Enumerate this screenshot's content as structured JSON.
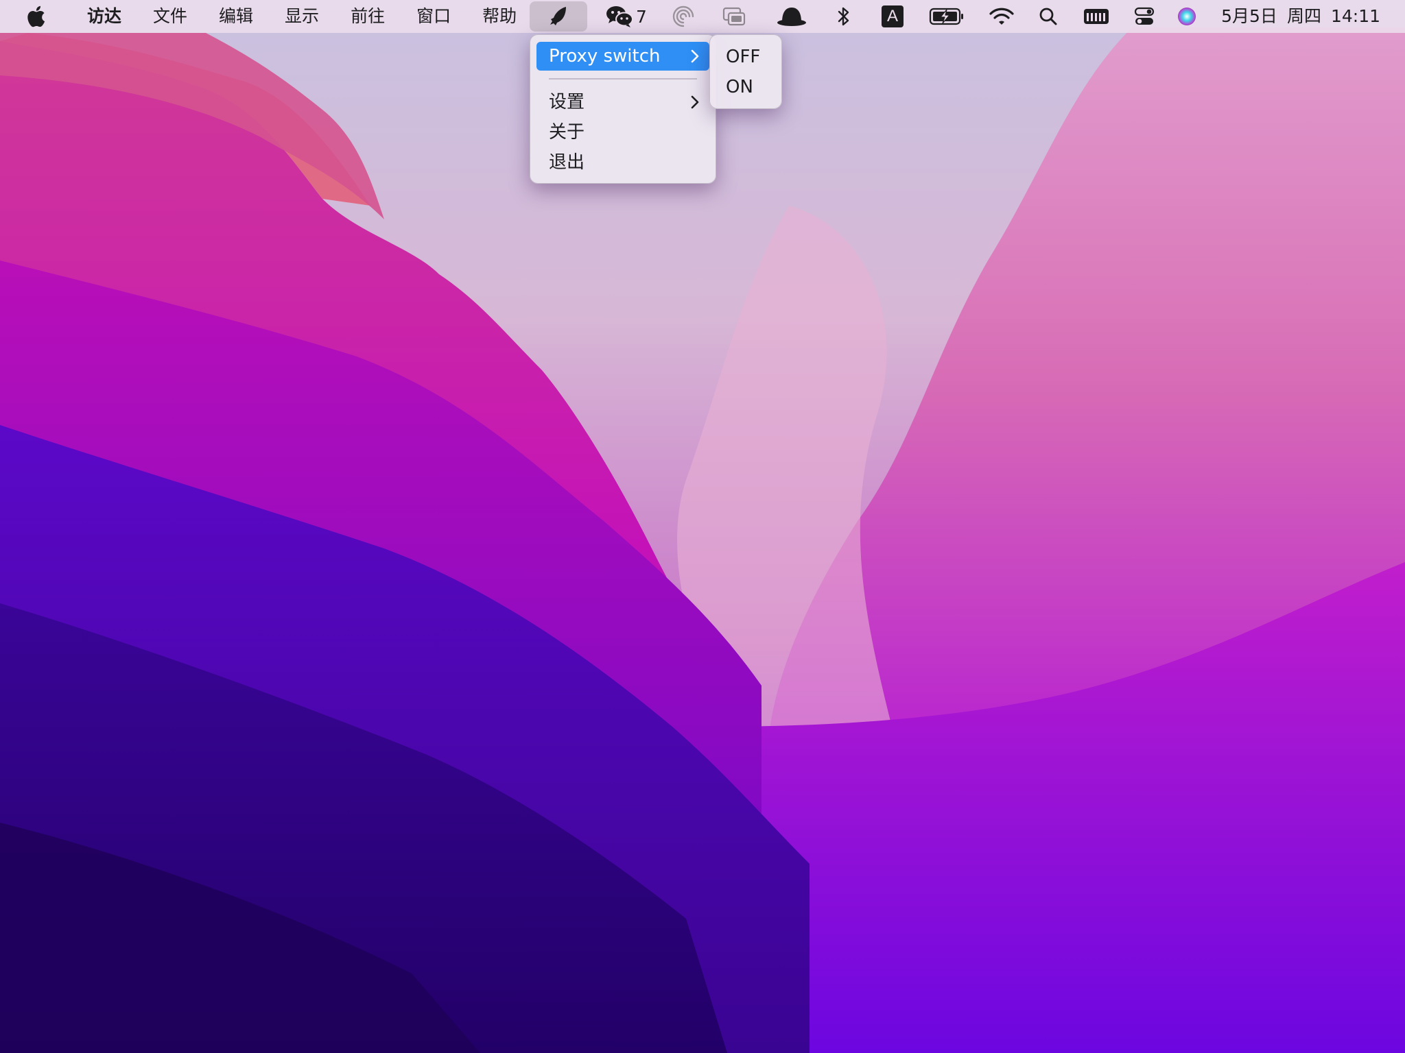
{
  "menubar": {
    "apple_icon": "apple-logo-icon",
    "app_name": "访达",
    "menus": [
      "文件",
      "编辑",
      "显示",
      "前往",
      "窗口",
      "帮助"
    ],
    "status_icons": {
      "proxy": "rocket-icon",
      "wechat": "wechat-icon",
      "wechat_count": "7",
      "activity": "spiral-icon",
      "screen_mirror": "screen-mirroring-icon",
      "alfred": "bowler-hat-icon",
      "bluetooth": "bluetooth-icon",
      "input_source": "A",
      "battery": "battery-charging-icon",
      "wifi": "wifi-icon",
      "spotlight": "search-icon",
      "keyboard": "keyboard-icon",
      "control_center": "control-center-icon",
      "siri": "siri-icon"
    },
    "date": "5月5日",
    "weekday": "周四",
    "time": "14:11"
  },
  "proxy_menu": {
    "items": [
      {
        "label": "Proxy switch",
        "has_submenu": true,
        "highlighted": true
      },
      {
        "label": "设置",
        "has_submenu": true
      },
      {
        "label": "关于"
      },
      {
        "label": "退出"
      }
    ],
    "submenu": {
      "items": [
        "OFF",
        "ON"
      ]
    }
  },
  "colors": {
    "menu_highlight": "#2f8ff5",
    "menubar_text": "#1d1d1f"
  }
}
